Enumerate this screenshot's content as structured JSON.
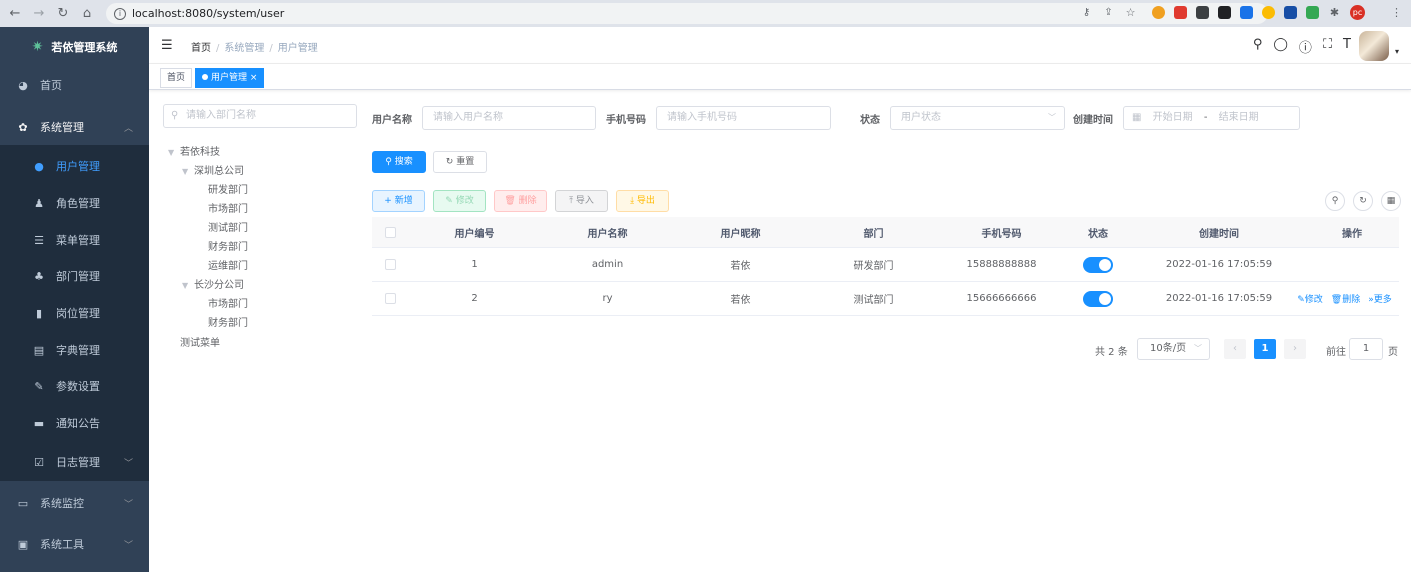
{
  "browser": {
    "url": "localhost:8080/system/user",
    "ext_label": "pc"
  },
  "sidebar": {
    "logo_text": "若依管理系统",
    "items": [
      {
        "label": "首页",
        "icon": "dashboard-icon"
      },
      {
        "label": "系统管理",
        "icon": "gear-icon"
      },
      {
        "label": "用户管理",
        "icon": "user-icon"
      },
      {
        "label": "角色管理",
        "icon": "peoples-icon"
      },
      {
        "label": "菜单管理",
        "icon": "tree-table-icon"
      },
      {
        "label": "部门管理",
        "icon": "tree-icon"
      },
      {
        "label": "岗位管理",
        "icon": "post-icon"
      },
      {
        "label": "字典管理",
        "icon": "dict-icon"
      },
      {
        "label": "参数设置",
        "icon": "edit-icon"
      },
      {
        "label": "通知公告",
        "icon": "message-icon"
      },
      {
        "label": "日志管理",
        "icon": "log-icon"
      },
      {
        "label": "系统监控",
        "icon": "monitor-icon"
      },
      {
        "label": "系统工具",
        "icon": "tool-icon"
      }
    ]
  },
  "header": {
    "breadcrumb": [
      "首页",
      "系统管理",
      "用户管理"
    ]
  },
  "tags": [
    "首页",
    "用户管理"
  ],
  "tree": {
    "placeholder": "请输入部门名称",
    "nodes": [
      "若依科技",
      "深圳总公司",
      "研发部门",
      "市场部门",
      "测试部门",
      "财务部门",
      "运维部门",
      "长沙分公司",
      "市场部门",
      "财务部门",
      "测试菜单"
    ]
  },
  "form": {
    "username_label": "用户名称",
    "username_placeholder": "请输入用户名称",
    "phone_label": "手机号码",
    "phone_placeholder": "请输入手机号码",
    "status_label": "状态",
    "status_placeholder": "用户状态",
    "created_label": "创建时间",
    "start_placeholder": "开始日期",
    "range_sep": "-",
    "end_placeholder": "结束日期",
    "search_btn": "搜索",
    "reset_btn": "重置"
  },
  "toolbar": {
    "add": "新增",
    "edit": "修改",
    "delete": "删除",
    "import": "导入",
    "export": "导出"
  },
  "table": {
    "headers": [
      "用户编号",
      "用户名称",
      "用户昵称",
      "部门",
      "手机号码",
      "状态",
      "创建时间",
      "操作"
    ],
    "rows": [
      {
        "id": "1",
        "username": "admin",
        "nickname": "若依",
        "dept": "研发部门",
        "phone": "15888888888",
        "status": "on",
        "created": "2022-01-16 17:05:59",
        "ops": []
      },
      {
        "id": "2",
        "username": "ry",
        "nickname": "若依",
        "dept": "测试部门",
        "phone": "15666666666",
        "status": "on",
        "created": "2022-01-16 17:05:59",
        "ops": [
          "修改",
          "删除",
          "更多"
        ]
      }
    ]
  },
  "pagination": {
    "total": "共 2 条",
    "page_size": "10条/页",
    "current": "1",
    "goto_label": "前往",
    "goto_value": "1",
    "page_suffix": "页"
  },
  "colors": {
    "sidebar_bg": "#304156",
    "submenu_bg": "#1f2d3d",
    "primary": "#1890ff"
  }
}
